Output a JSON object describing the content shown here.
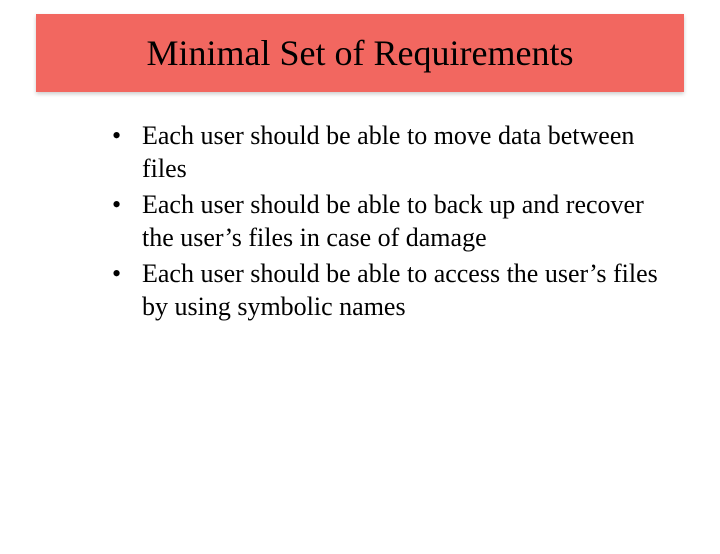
{
  "title": "Minimal Set of Requirements",
  "bullets": [
    "Each user should be able to move data between files",
    "Each user should be able to back up and recover the user’s files in case of damage",
    "Each user should be able to access the user’s files by using symbolic names"
  ]
}
